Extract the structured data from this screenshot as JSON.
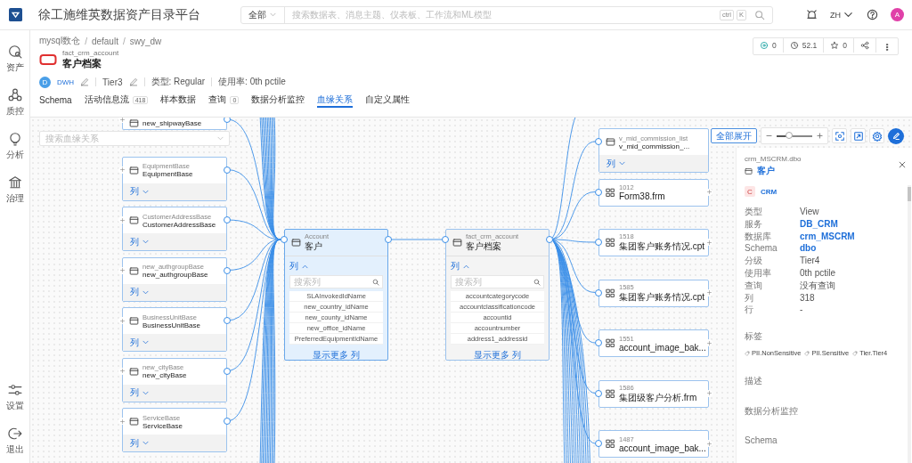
{
  "header": {
    "title": "徐工施维英数据资产目录平台",
    "search": {
      "scope": "全部",
      "placeholder": "搜索数据表、消息主题、仪表板、工作流和ML模型",
      "keys": [
        "ctrl",
        "K"
      ]
    },
    "language": "ZH",
    "avatar": "A"
  },
  "sidebar": {
    "items": [
      {
        "label": "资产",
        "selected": false
      },
      {
        "label": "质控",
        "selected": false
      },
      {
        "label": "分析",
        "selected": false
      },
      {
        "label": "治理",
        "selected": false
      }
    ],
    "bottom_items": [
      {
        "label": "设置",
        "selected": false
      },
      {
        "label": "退出",
        "selected": false
      }
    ]
  },
  "breadcrumb": [
    "mysql数仓",
    "/",
    "default",
    "/",
    "swy_dw"
  ],
  "entity": {
    "name": "fact_crm_account",
    "display_name": "客户档案",
    "owner_initial": "D",
    "owner": "DWH",
    "tier": "Tier3",
    "type": "类型: Regular",
    "usage": "使用率: 0th pctile"
  },
  "stats": [
    {
      "kind": "follow",
      "value": "0"
    },
    {
      "kind": "views",
      "value": "52.1"
    },
    {
      "kind": "star",
      "value": "0"
    },
    {
      "kind": "share"
    },
    {
      "kind": "more"
    }
  ],
  "tabs": [
    {
      "label": "Schema",
      "selected": false
    },
    {
      "label": "活动信息流",
      "count": "418",
      "selected": false
    },
    {
      "label": "样本数据",
      "selected": false
    },
    {
      "label": "查询",
      "count": "0",
      "selected": false
    },
    {
      "label": "数据分析监控",
      "selected": false
    },
    {
      "label": "血缘关系",
      "selected": true
    },
    {
      "label": "自定义属性",
      "selected": false
    }
  ],
  "lineage": {
    "search_placeholder": "搜索血缘关系",
    "expand_all": "全部展开",
    "zoom": {
      "level": 0.35
    },
    "upstream": [
      {
        "kind": "table",
        "name": "new_shipwayBase"
      },
      {
        "kind": "table",
        "subtitle": "EquipmentBase",
        "name": "EquipmentBase",
        "columns_label": "列",
        "expanded": false
      },
      {
        "kind": "table",
        "subtitle": "CustomerAddressBase",
        "name": "CustomerAddressBase",
        "columns_label": "列",
        "expanded": false
      },
      {
        "kind": "table",
        "subtitle": "new_authgroupBase",
        "name": "new_authgroupBase",
        "columns_label": "列",
        "expanded": false
      },
      {
        "kind": "table",
        "subtitle": "BusinessUnitBase",
        "name": "BusinessUnitBase",
        "columns_label": "列",
        "expanded": false
      },
      {
        "kind": "table",
        "subtitle": "new_cityBase",
        "name": "new_cityBase",
        "columns_label": "列",
        "expanded": false
      },
      {
        "kind": "table",
        "subtitle": "ServiceBase",
        "name": "ServiceBase",
        "columns_label": "列",
        "expanded": false
      }
    ],
    "center": [
      {
        "subtitle": "Account",
        "name": "客户",
        "selected": true,
        "columns_label": "列",
        "expanded": true,
        "search_placeholder": "搜索列",
        "columns": [
          "SLAInvokedIdName",
          "new_country_idName",
          "new_county_idName",
          "new_office_idName",
          "PreferredEquipmentIdName"
        ],
        "more": "显示更多 列"
      },
      {
        "subtitle": "fact_crm_account",
        "name": "客户档案",
        "selected": false,
        "columns_label": "列",
        "expanded": true,
        "search_placeholder": "搜索列",
        "columns": [
          "accountcategorycode",
          "accountclassificationcode",
          "accountid",
          "accountnumber",
          "address1_addressid"
        ],
        "more": "显示更多 列"
      }
    ],
    "downstream": [
      {
        "kind": "table",
        "subtitle": "v_mid_commission_list",
        "name": "v_mid_commission_...",
        "columns_label": "列",
        "expanded": false
      },
      {
        "kind": "report",
        "subtitle": "1012",
        "name": "Form38.frm"
      },
      {
        "kind": "report",
        "subtitle": "1518",
        "name": "集团客户账务情况.cpt"
      },
      {
        "kind": "report",
        "subtitle": "1585",
        "name": "集团客户账务情况.cpt"
      },
      {
        "kind": "report",
        "subtitle": "1551",
        "name": "account_image_bak..."
      },
      {
        "kind": "report",
        "subtitle": "1586",
        "name": "集团级客户分析.frm"
      },
      {
        "kind": "report",
        "subtitle": "1487",
        "name": "account_image_bak..."
      }
    ]
  },
  "detail": {
    "path": "crm_MSCRM.dbo",
    "title": "客户",
    "service_badge": "C",
    "service": "CRM",
    "properties": [
      {
        "label": "类型",
        "value": "View",
        "link": false
      },
      {
        "label": "服务",
        "value": "DB_CRM",
        "link": true
      },
      {
        "label": "数据库",
        "value": "crm_MSCRM",
        "link": true
      },
      {
        "label": "Schema",
        "value": "dbo",
        "link": true
      },
      {
        "label": "分级",
        "value": "Tier4",
        "link": false
      },
      {
        "label": "使用率",
        "value": "0th pctile",
        "link": false
      },
      {
        "label": "查询",
        "value": "没有查询",
        "link": false
      },
      {
        "label": "列",
        "value": "318",
        "link": false
      },
      {
        "label": "行",
        "value": "-",
        "link": false
      }
    ],
    "tags_heading": "标签",
    "tags": [
      "PII.NonSensitive",
      "PII.Sensitive",
      "Tier.Tier4"
    ],
    "sections": [
      "描述",
      "数据分析监控",
      "Schema"
    ]
  }
}
